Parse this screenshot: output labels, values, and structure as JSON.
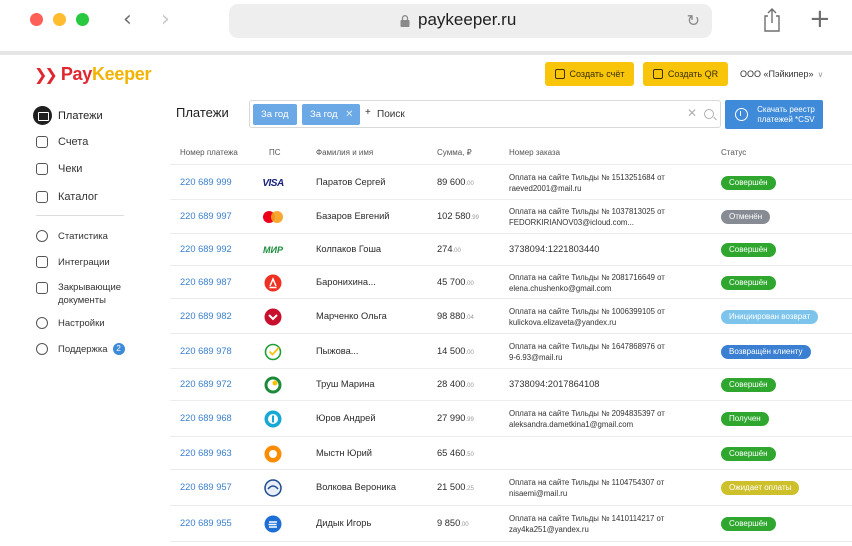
{
  "browser": {
    "url": "paykeeper.ru"
  },
  "header": {
    "logo_pay": "Pay",
    "logo_keeper": "Keeper",
    "create_invoice": "Создать счёт",
    "create_qr": "Создать QR",
    "company": "ООО «Пэйкипер»"
  },
  "sidebar": {
    "items": [
      {
        "label": "Платежи",
        "icon": "payments-icon"
      },
      {
        "label": "Счета",
        "icon": "invoices-icon"
      },
      {
        "label": "Чеки",
        "icon": "receipts-icon"
      },
      {
        "label": "Каталог",
        "icon": "catalog-icon"
      },
      {
        "label": "Статистика",
        "icon": "statistics-icon"
      },
      {
        "label": "Интеграции",
        "icon": "integrations-icon"
      },
      {
        "label": "Закрывающие документы",
        "icon": "documents-icon"
      },
      {
        "label": "Настройки",
        "icon": "settings-icon"
      },
      {
        "label": "Поддержка",
        "icon": "support-icon",
        "badge": "2"
      }
    ]
  },
  "main": {
    "title": "Платежи",
    "filters": [
      "За год",
      "За год"
    ],
    "search_placeholder": "Поиск",
    "csv_button": "Скачать реестр платежей *CSV"
  },
  "table": {
    "columns": [
      "Номер платежа",
      "ПС",
      "Фамилия и имя",
      "Сумма, ₽",
      "Номер заказа",
      "Статус"
    ],
    "rows": [
      {
        "num": "220 689 999",
        "ps": "visa",
        "name": "Паратов Сергей",
        "sum": "89 600",
        "cents": ".00",
        "order1": "Оплата на сайте Тильды № 1513251684 от",
        "order2": "raeved2001@mail.ru",
        "status": "Совершён"
      },
      {
        "num": "220 689 997",
        "ps": "mastercard",
        "name": "Базаров Евгений",
        "sum": "102 580",
        "cents": ".99",
        "order1": "Оплата на сайте Тильды № 1037813025 от",
        "order2": "FEDORKIRIANOV03@icloud.com...",
        "status": "Отменён"
      },
      {
        "num": "220 689 992",
        "ps": "mir",
        "name": "Колпаков Гоша",
        "sum": "274",
        "cents": ".00",
        "order1": "3738094:1221803440",
        "order2": "",
        "status": "Совершён"
      },
      {
        "num": "220 689 987",
        "ps": "alfa",
        "name": "Баронихина...",
        "sum": "45 700",
        "cents": ".00",
        "order1": "Оплата на сайте Тильды № 2081716649 от",
        "order2": "elena.chushenko@gmail.com",
        "status": "Совершён"
      },
      {
        "num": "220 689 982",
        "ps": "psb",
        "name": "Марченко Ольга",
        "sum": "98 880",
        "cents": ".04",
        "order1": "Оплата на сайте Тильды № 1006399105 от",
        "order2": "kulickova.elizaveta@yandex.ru",
        "status": "Инициирован возврат"
      },
      {
        "num": "220 689 978",
        "ps": "sber",
        "name": "Пыжова...",
        "sum": "14 500",
        "cents": ".00",
        "order1": "Оплата на сайте Тильды № 1647868976 от",
        "order2": "9-6.93@mail.ru",
        "status": "Возвращён клиенту"
      },
      {
        "num": "220 689 972",
        "ps": "rshb",
        "name": "Труш Марина",
        "sum": "28 400",
        "cents": ".00",
        "order1": "3738094:2017864108",
        "order2": "",
        "status": "Совершён"
      },
      {
        "num": "220 689 968",
        "ps": "tinkoff-pay",
        "name": "Юров Андрей",
        "sum": "27 990",
        "cents": ".99",
        "order1": "Оплата на сайте Тильды № 2094835397 от",
        "order2": "aleksandra.dametkina1@gmail.com",
        "status": "Получен"
      },
      {
        "num": "220 689 963",
        "ps": "qiwi",
        "name": "Мыстн Юрий",
        "sum": "65 460",
        "cents": ".50",
        "order1": "",
        "order2": "",
        "status": "Совершён"
      },
      {
        "num": "220 689 957",
        "ps": "gazprom",
        "name": "Волкова Вероника",
        "sum": "21 500",
        "cents": ".25",
        "order1": "Оплата на сайте Тильды № 1104754307 от",
        "order2": "nisaemi@mail.ru",
        "status": "Ожидает оплаты"
      },
      {
        "num": "220 689 955",
        "ps": "vtb-pay",
        "name": "Дидык Игорь",
        "sum": "9 850",
        "cents": ".00",
        "order1": "Оплата на сайте Тильды № 1410114217 от",
        "order2": "zay4ka251@yandex.ru",
        "status": "Совершён"
      }
    ]
  },
  "colors": {
    "accent_blue": "#3f8bd9",
    "brand_red": "#e0262f",
    "brand_yellow": "#f9c50a",
    "status_done": "#2fa72f",
    "status_cancel": "#878c94"
  }
}
